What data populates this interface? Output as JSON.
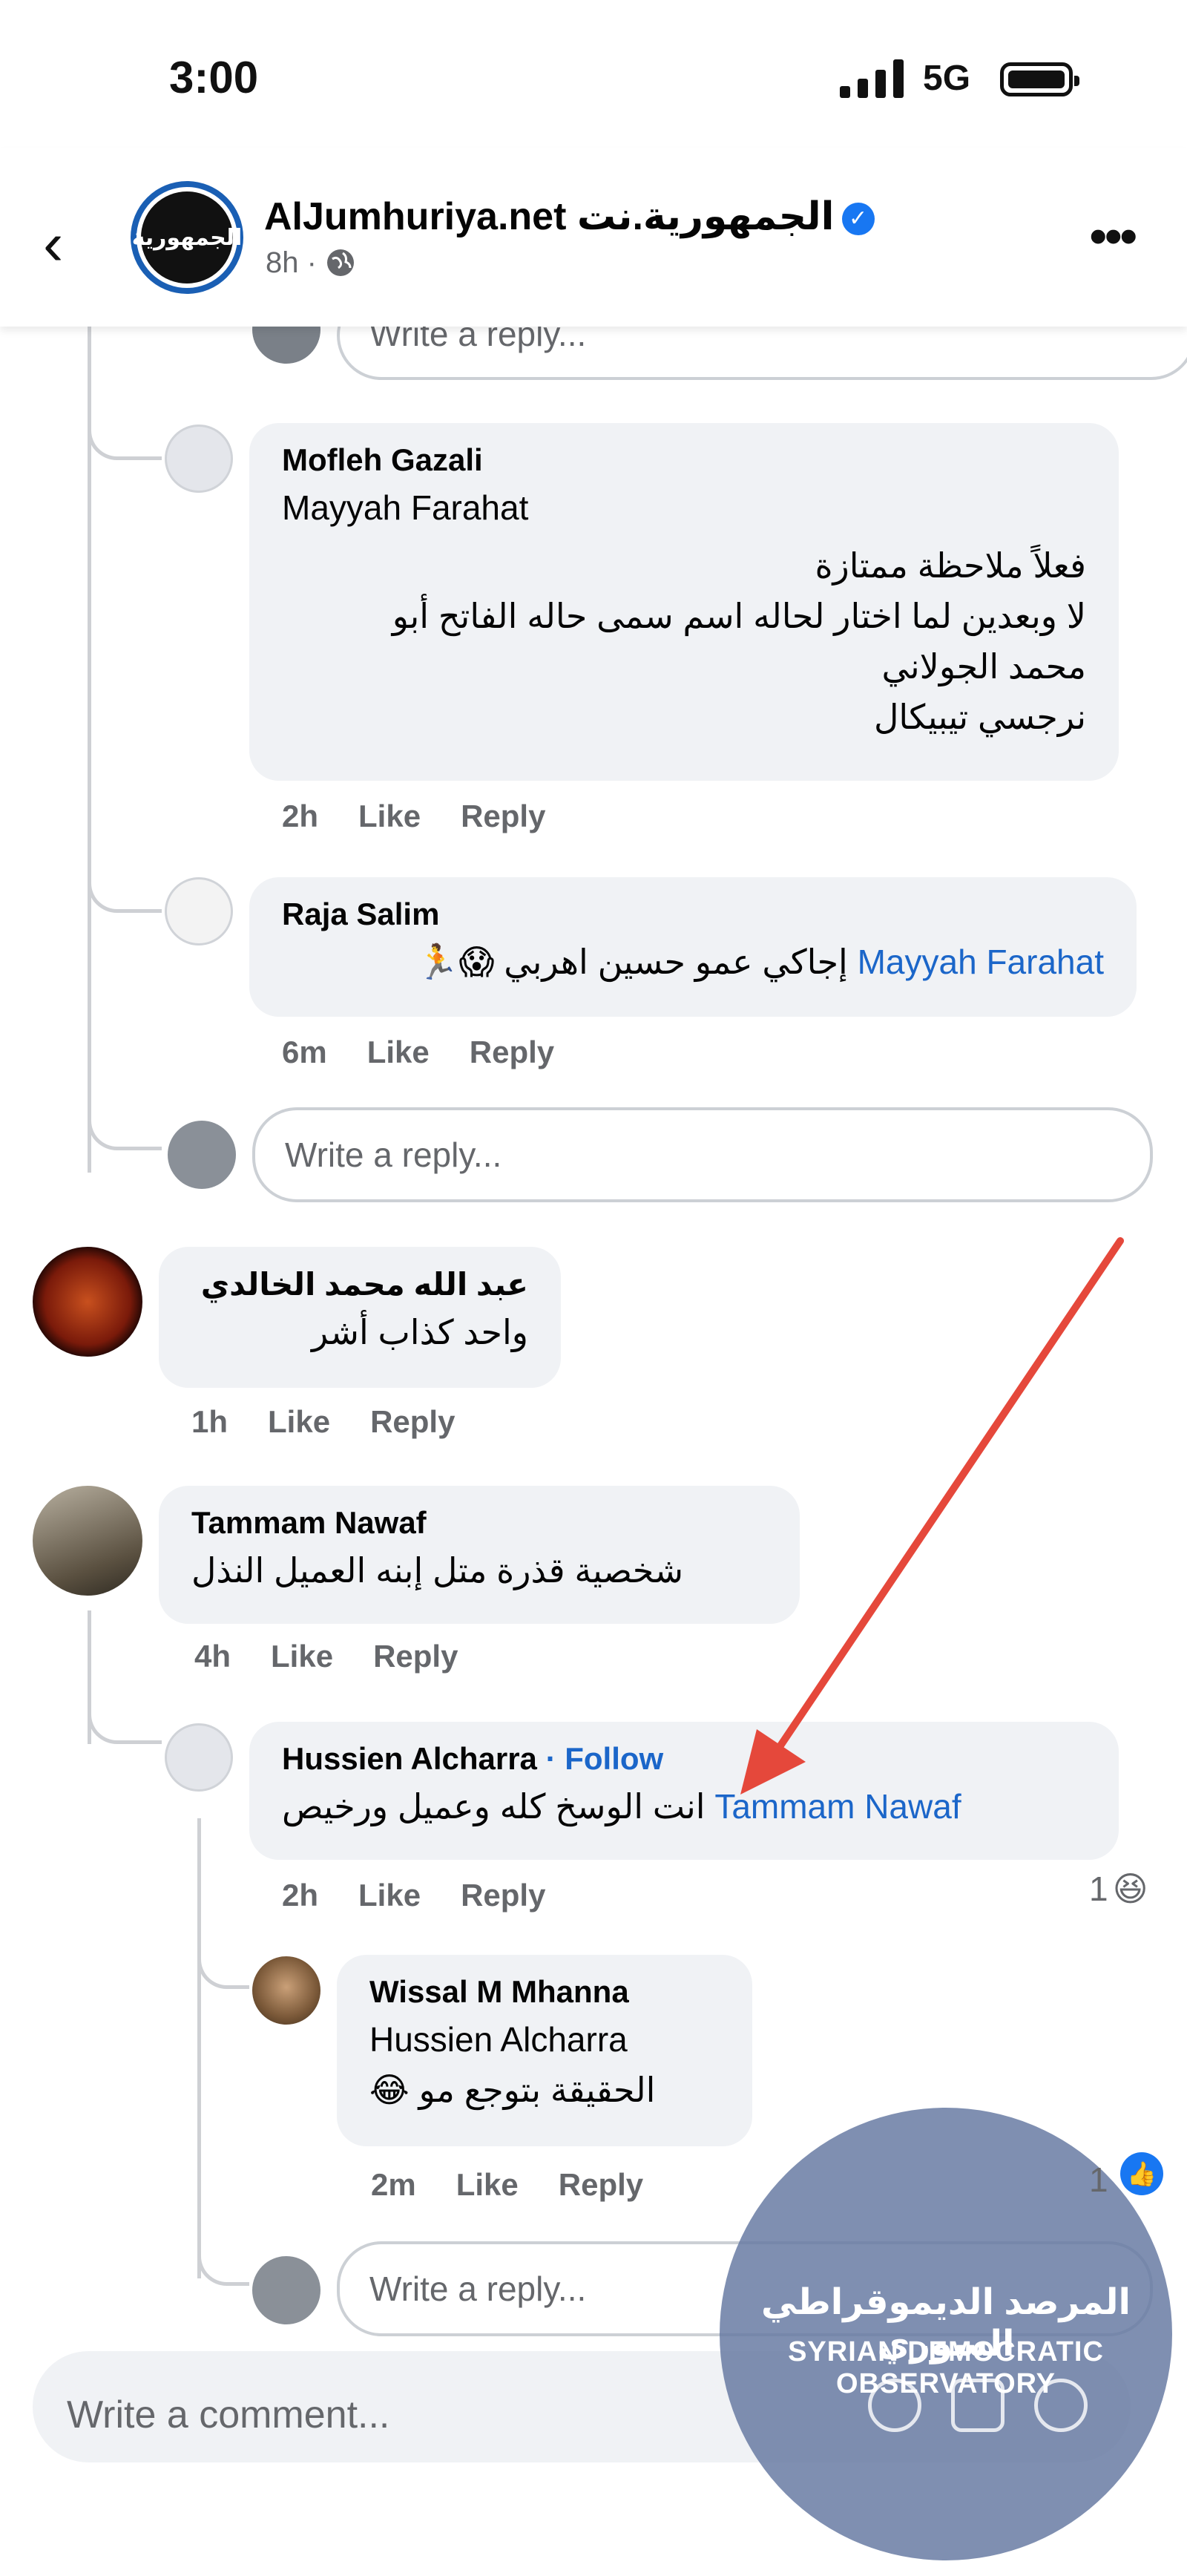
{
  "status_bar": {
    "time": "3:00",
    "network": "5G"
  },
  "header": {
    "page_name": "AlJumhuriya.net  الجمهورية.نت",
    "meta": "8h ·",
    "avatar_text": "الجمهورية"
  },
  "top_reply_placeholder": "Write a reply...",
  "comments": {
    "mofleh": {
      "name": "Mofleh Gazali",
      "mention": "Mayyah Farahat",
      "lines": [
        "فعلاً ملاحظة ممتازة",
        "لا وبعدين لما اختار لحاله اسم سمى حاله الفاتح أبو",
        "محمد الجولاني",
        "نرجسي تيبيكال"
      ],
      "time": "2h",
      "like": "Like",
      "reply": "Reply"
    },
    "raja": {
      "name": "Raja Salim",
      "mention": "Mayyah Farahat",
      "text": "إجاكي عمو حسين اهربي 😱🏃",
      "time": "6m",
      "like": "Like",
      "reply": "Reply"
    },
    "reply_placeholder_1": "Write a reply...",
    "abdullah": {
      "name": "عبد الله محمد الخالدي",
      "text": "واحد كذاب أشر",
      "time": "1h",
      "like": "Like",
      "reply": "Reply"
    },
    "tammam": {
      "name": "Tammam Nawaf",
      "text": "شخصية قذرة متل إبنه العميل النذل",
      "time": "4h",
      "like": "Like",
      "reply": "Reply"
    },
    "hussien": {
      "name": "Hussien Alcharra",
      "follow": "· Follow",
      "mention": "Tammam Nawaf",
      "text": "انت الوسخ كله  وعميل ورخيص",
      "time": "2h",
      "like": "Like",
      "reply": "Reply",
      "reaction_count": "1",
      "reaction": "😆"
    },
    "wissal": {
      "name": "Wissal M Mhanna",
      "mention": "Hussien Alcharra",
      "text": "الحقيقة بتوجع مو 😂",
      "time": "2m",
      "like": "Like",
      "reply": "Reply",
      "reaction_count": "1"
    },
    "reply_placeholder_2": "Write a reply..."
  },
  "composer": {
    "placeholder": "Write a comment..."
  },
  "watermark": {
    "arabic": "المرصد الديموقراطي السوري",
    "english": "SYRIAN DEMOCRATIC OBSERVATORY"
  },
  "colors": {
    "mention": "#1b66c9",
    "verified": "#1877f2",
    "arrow": "#e5483b",
    "bubble": "#f0f2f5"
  },
  "icons": [
    "chevron-left-icon",
    "globe-icon",
    "verified-badge-icon",
    "more-icon",
    "emoji-icon",
    "gif-icon",
    "sticker-icon",
    "like-reaction-icon"
  ]
}
